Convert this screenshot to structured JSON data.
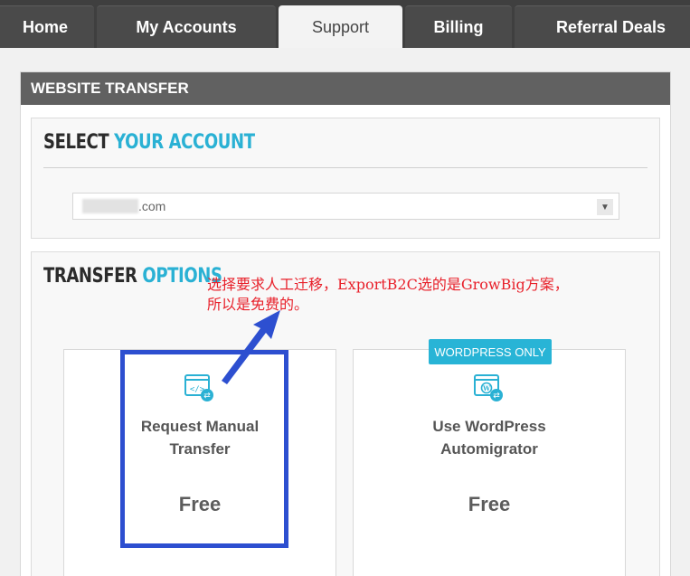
{
  "nav": {
    "tabs": [
      {
        "label": "Home"
      },
      {
        "label": "My Accounts"
      },
      {
        "label": "Support"
      },
      {
        "label": "Billing"
      },
      {
        "label": "Referral Deals"
      }
    ],
    "active": "Support"
  },
  "panel": {
    "title": "WEBSITE TRANSFER"
  },
  "select_account": {
    "title_part1": "SELECT",
    "title_part2": "YOUR ACCOUNT",
    "domain_suffix": ".com"
  },
  "transfer_options": {
    "title_part1": "TRANSFER",
    "title_part2": "OPTIONS",
    "cards": [
      {
        "name_line1": "Request Manual",
        "name_line2": "Transfer",
        "price": "Free",
        "icon": "code-transfer-icon"
      },
      {
        "badge": "WORDPRESS ONLY",
        "name_line1": "Use WordPress",
        "name_line2": "Automigrator",
        "price": "Free",
        "icon": "wordpress-transfer-icon"
      }
    ]
  },
  "annotation": {
    "line1": "选择要求人工迁移，ExportB2C选的是GrowBig方案，",
    "line2": "所以是免费的。"
  },
  "colors": {
    "accent": "#2ab1d4",
    "annotation_red": "#e8202a",
    "highlight_blue": "#2d4fd0",
    "header_gray": "#616161"
  }
}
